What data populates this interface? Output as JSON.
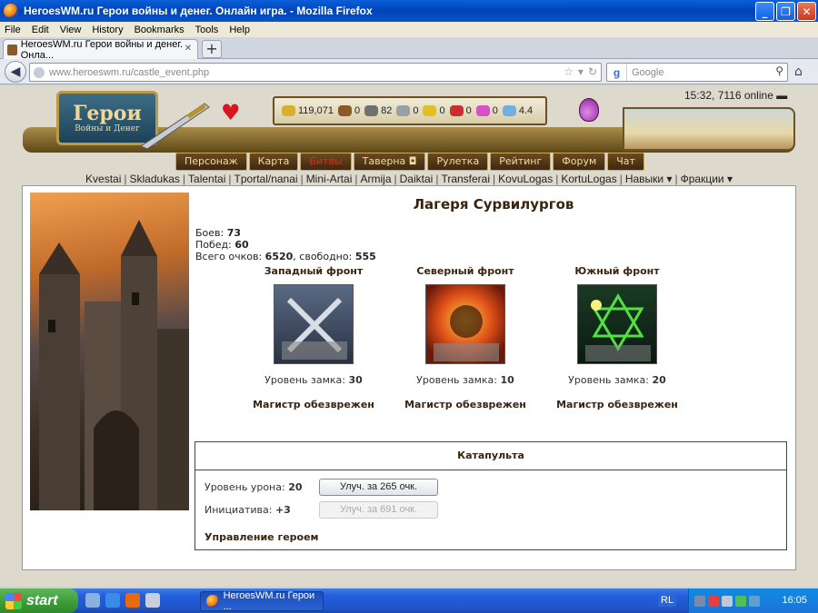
{
  "window": {
    "title": "HeroesWM.ru Герои войны и денег. Онлайн игра. - Mozilla Firefox"
  },
  "menu": [
    "File",
    "Edit",
    "View",
    "History",
    "Bookmarks",
    "Tools",
    "Help"
  ],
  "tab": {
    "label": "HeroesWM.ru Герои войны и денег. Онла..."
  },
  "address": {
    "host": "www.heroeswm.ru",
    "path": "/castle_event.php"
  },
  "search": {
    "placeholder": "Google"
  },
  "header": {
    "logo_title": "Герои",
    "logo_subtitle": "Войны и Денег",
    "time_online": "15:32, 7116 online",
    "resources": [
      {
        "icon": "gold-icon",
        "value": "119,071",
        "color": "#d8b030"
      },
      {
        "icon": "wood-icon",
        "value": "0",
        "color": "#8a5a2a"
      },
      {
        "icon": "ore-icon",
        "value": "82",
        "color": "#707070"
      },
      {
        "icon": "mercury-icon",
        "value": "0",
        "color": "#9aa0a8"
      },
      {
        "icon": "sulfur-icon",
        "value": "0",
        "color": "#e0c020"
      },
      {
        "icon": "crystal-icon",
        "value": "0",
        "color": "#c83030"
      },
      {
        "icon": "gems-icon",
        "value": "0",
        "color": "#d850c8"
      },
      {
        "icon": "diamond-icon",
        "value": "4.4",
        "color": "#70b0e0"
      }
    ]
  },
  "mainnav": [
    {
      "label": "Персонаж",
      "red": false
    },
    {
      "label": "Карта",
      "red": false
    },
    {
      "label": "Битвы",
      "red": true
    },
    {
      "label": "Таверна ◘",
      "red": false
    },
    {
      "label": "Рулетка",
      "red": false
    },
    {
      "label": "Рейтинг",
      "red": false
    },
    {
      "label": "Форум",
      "red": false
    },
    {
      "label": "Чат",
      "red": false
    }
  ],
  "subnav": [
    "Kvestai",
    "Skladukas",
    "Talentai",
    "Tportal/nanai",
    "Mini-Artai",
    "Armija",
    "Daiktai",
    "Transferai",
    "KovuLogas",
    "KortuLogas",
    "Навыки ▾",
    "Фракции ▾"
  ],
  "content": {
    "title": "Лагеря Сурвилургов",
    "battles_label": "Боев:",
    "battles_value": "73",
    "wins_label": "Побед:",
    "wins_value": "60",
    "points_label": "Всего очков:",
    "points_value": "6520",
    "free_label": ", свободно:",
    "free_value": "555",
    "fronts": [
      {
        "name": "Западный фронт",
        "level_label": "Уровень замка:",
        "level": "30",
        "status": "Магистр обезврежен"
      },
      {
        "name": "Северный фронт",
        "level_label": "Уровень замка:",
        "level": "10",
        "status": "Магистр обезврежен"
      },
      {
        "name": "Южный фронт",
        "level_label": "Уровень замка:",
        "level": "20",
        "status": "Магистр обезврежен"
      }
    ],
    "catapult": {
      "title": "Катапульта",
      "damage_label": "Уровень урона:",
      "damage_value": "20",
      "damage_button": "Улуч. за 265 очк.",
      "initiative_label": "Инициатива:",
      "initiative_value": "+3",
      "initiative_button": "Улуч. за 691 очк.",
      "hero_link": "Управление героем"
    }
  },
  "taskbar": {
    "start": "start",
    "task": "HeroesWM.ru Герои ...",
    "lang": "RL",
    "clock": "16:05"
  }
}
